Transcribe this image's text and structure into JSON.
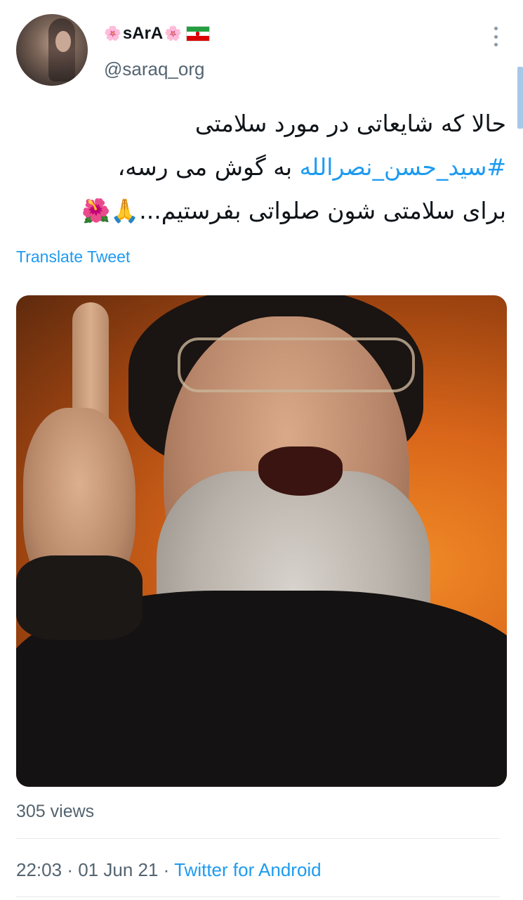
{
  "tweet": {
    "author": {
      "name": "sArA",
      "name_prefix_emoji": "🌸",
      "name_suffix_emoji": "🌸",
      "flag_icon": "iran-flag-icon",
      "handle": "@saraq_org"
    },
    "text_lines": [
      "حالا که شایعاتی در مورد سلامتی",
      "به گوش می رسه،",
      "برای سلامتی شون صلواتی بفرستیم..."
    ],
    "hashtag": "#سید_حسن_نصرالله",
    "trailing_emojis": "🙏🌺",
    "translate_label": "Translate Tweet",
    "views": "305 views",
    "time": "22:03",
    "separator": "·",
    "date": "01 Jun 21",
    "source": "Twitter for Android"
  },
  "colors": {
    "link": "#1d9bf0",
    "secondary_text": "#536471",
    "primary_text": "#0f1419"
  }
}
